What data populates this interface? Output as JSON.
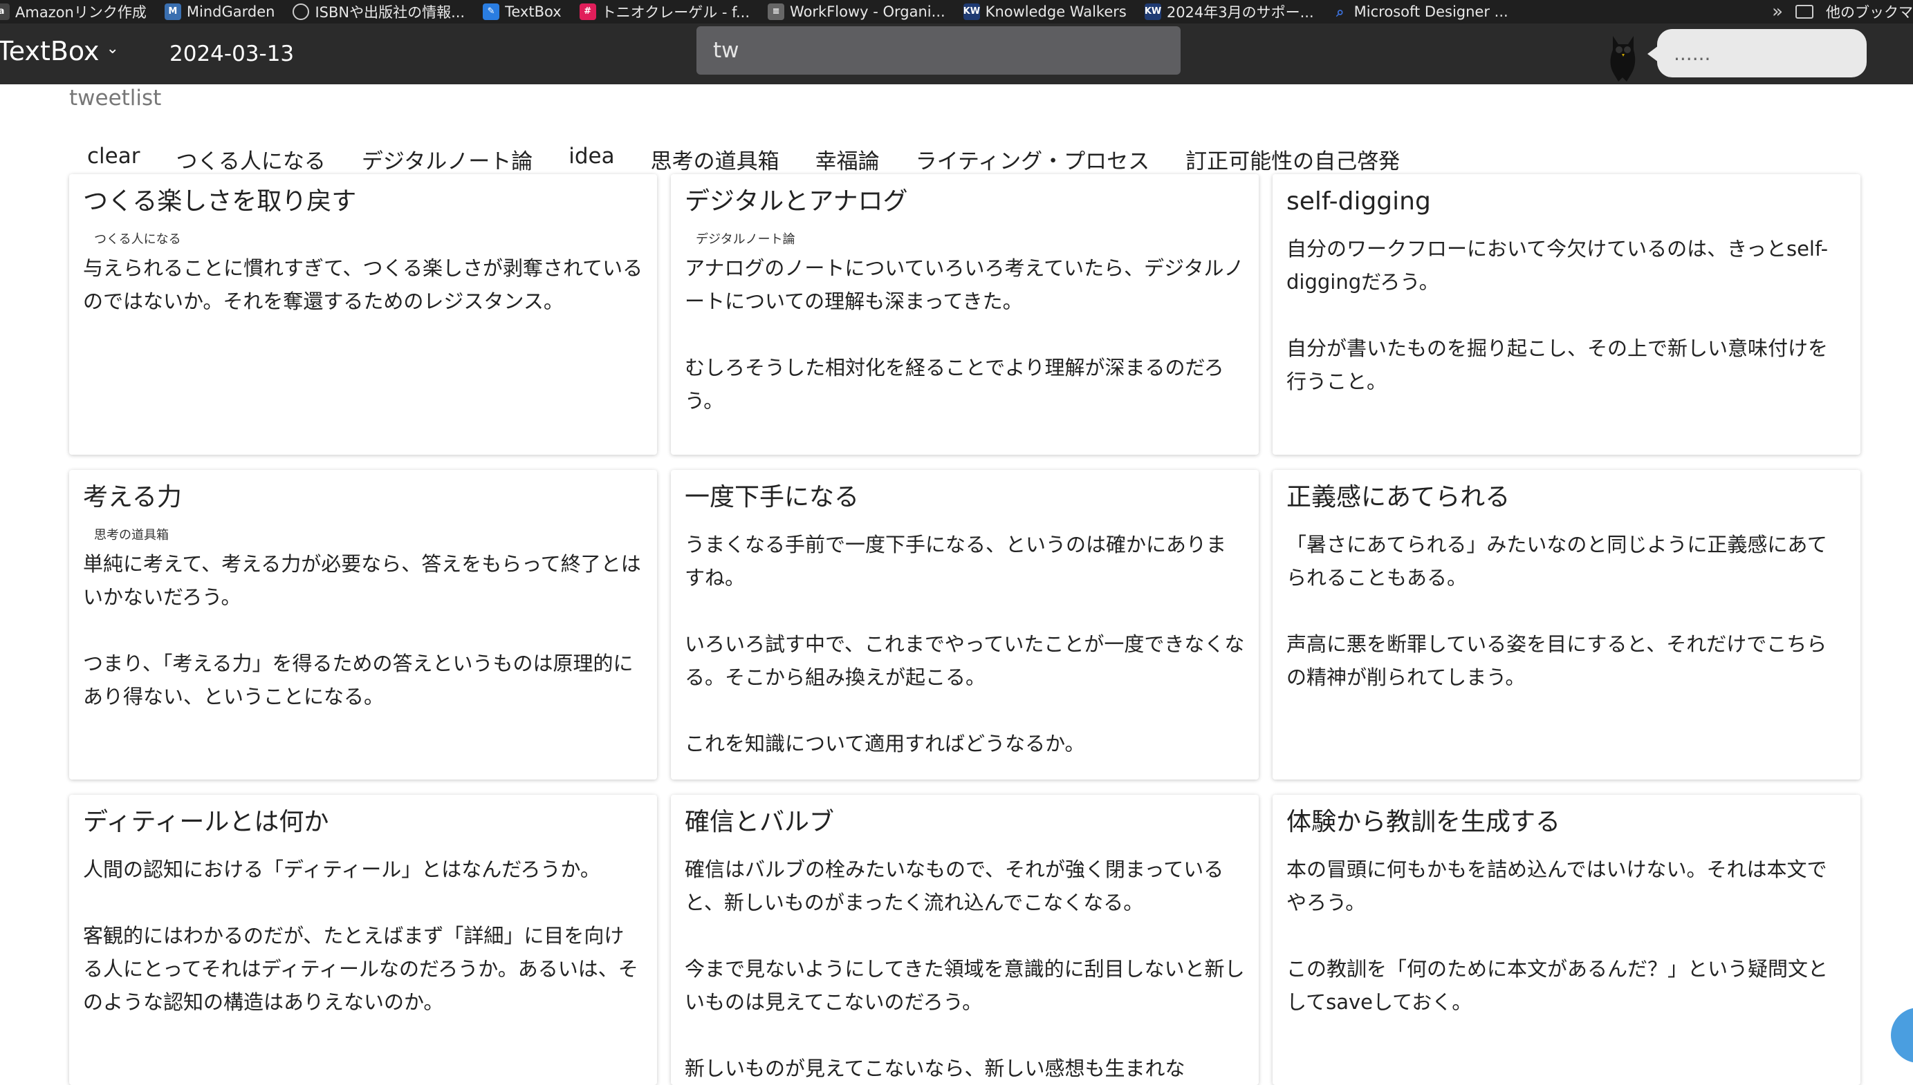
{
  "bookmarks": [
    {
      "label": "Amazonリンク作成",
      "icon": "amazon-icon",
      "color": "#444"
    },
    {
      "label": "MindGarden",
      "icon": "mindgarden-icon",
      "color": "#3a6fb0"
    },
    {
      "label": "ISBNや出版社の情報...",
      "icon": "globe-icon",
      "color": "#555"
    },
    {
      "label": "TextBox",
      "icon": "textbox-icon",
      "color": "#2a7de1"
    },
    {
      "label": "トニオクレーゲル - f...",
      "icon": "slack-icon",
      "color": "#e01e5a"
    },
    {
      "label": "WorkFlowy - Organi...",
      "icon": "workflowy-icon",
      "color": "#666"
    },
    {
      "label": "Knowledge Walkers",
      "icon": "kw-icon",
      "color": "#1f3b73"
    },
    {
      "label": "2024年3月のサポー...",
      "icon": "kw-icon",
      "color": "#1f3b73"
    },
    {
      "label": "Microsoft Designer ...",
      "icon": "search-icon",
      "color": "#3b6fd8"
    }
  ],
  "bookmarks_other": "他のブックマ",
  "app": {
    "name": "TextBox",
    "date": "2024-03-13",
    "search_value": "tw",
    "bubble_text": "......"
  },
  "page_title": "tweetlist",
  "tabs": [
    "clear",
    "つくる人になる",
    "デジタルノート論",
    "idea",
    "思考の道具箱",
    "幸福論",
    "ライティング・プロセス",
    "訂正可能性の自己啓発"
  ],
  "cards": [
    {
      "title": "つくる楽しさを取り戻す",
      "tag": "つくる人になる",
      "body": "与えられることに慣れすぎて、つくる楽しさが剥奪されているのではないか。それを奪還するためのレジスタンス。"
    },
    {
      "title": "デジタルとアナログ",
      "tag": "デジタルノート論",
      "body": "アナログのノートについていろいろ考えていたら、デジタルノートについての理解も深まってきた。\n\nむしろそうした相対化を経ることでより理解が深まるのだろう。"
    },
    {
      "title": "self-digging",
      "tag": "",
      "body": "自分のワークフローにおいて今欠けているのは、きっとself-diggingだろう。\n\n自分が書いたものを掘り起こし、その上で新しい意味付けを行うこと。"
    },
    {
      "title": "考える力",
      "tag": "思考の道具箱",
      "body": "単純に考えて、考える力が必要なら、答えをもらって終了とはいかないだろう。\n\nつまり、「考える力」を得るための答えというものは原理的にあり得ない、ということになる。"
    },
    {
      "title": "一度下手になる",
      "tag": "",
      "body": "うまくなる手前で一度下手になる、というのは確かにありますね。\n\nいろいろ試す中で、これまでやっていたことが一度できなくなる。そこから組み換えが起こる。\n\nこれを知識について適用すればどうなるか。"
    },
    {
      "title": "正義感にあてられる",
      "tag": "",
      "body": "「暑さにあてられる」みたいなのと同じように正義感にあてられることもある。\n\n声高に悪を断罪している姿を目にすると、それだけでこちらの精神が削られてしまう。"
    },
    {
      "title": "ディティールとは何か",
      "tag": "",
      "body": "人間の認知における「ディティール」とはなんだろうか。\n\n客観的にはわかるのだが、たとえばまず「詳細」に目を向ける人にとってそれはディティールなのだろうか。あるいは、そのような認知の構造はありえないのか。"
    },
    {
      "title": "確信とバルブ",
      "tag": "",
      "body": "確信はバルブの栓みたいなもので、それが強く閉まっていると、新しいものがまったく流れ込んでこなくなる。\n\n今まで見ないようにしてきた領域を意識的に刮目しないと新しいものは見えてこないのだろう。\n\n新しいものが見えてこないなら、新しい感想も生まれな"
    },
    {
      "title": "体験から教訓を生成する",
      "tag": "",
      "body": "本の冒頭に何もかもを詰め込んではいけない。それは本文でやろう。\n\nこの教訓を「何のために本文があるんだ？」という疑問文としてsaveしておく。"
    }
  ]
}
